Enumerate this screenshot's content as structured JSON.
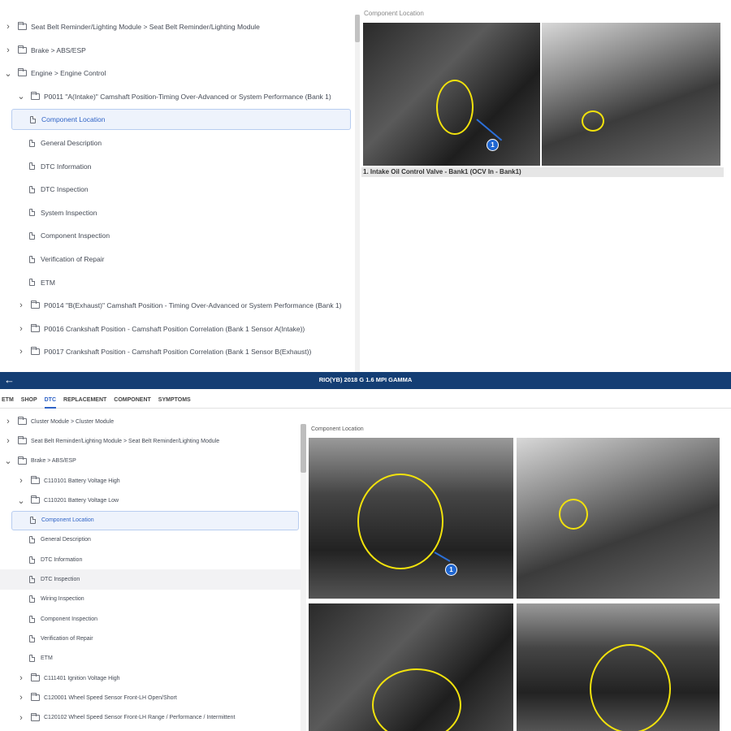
{
  "top": {
    "tree": [
      {
        "indent": 0,
        "chev": "›",
        "icon": "folder",
        "label": "Seat Belt Reminder/Lighting Module > Seat Belt Reminder/Lighting Module"
      },
      {
        "indent": 0,
        "chev": "›",
        "icon": "folder",
        "label": "Brake > ABS/ESP"
      },
      {
        "indent": 0,
        "chev": "⌄",
        "icon": "folder",
        "label": "Engine > Engine Control"
      },
      {
        "indent": 1,
        "chev": "⌄",
        "icon": "folder",
        "label": "P0011 \"A(Intake)\" Camshaft Position-Timing Over-Advanced or System Performance (Bank 1)"
      },
      {
        "indent": 2,
        "chev": "",
        "icon": "doc",
        "label": "Component Location",
        "selected": true
      },
      {
        "indent": 2,
        "chev": "",
        "icon": "doc",
        "label": "General Description"
      },
      {
        "indent": 2,
        "chev": "",
        "icon": "doc",
        "label": "DTC Information"
      },
      {
        "indent": 2,
        "chev": "",
        "icon": "doc",
        "label": "DTC Inspection"
      },
      {
        "indent": 2,
        "chev": "",
        "icon": "doc",
        "label": "System Inspection"
      },
      {
        "indent": 2,
        "chev": "",
        "icon": "doc",
        "label": "Component Inspection"
      },
      {
        "indent": 2,
        "chev": "",
        "icon": "doc",
        "label": "Verification of Repair"
      },
      {
        "indent": 2,
        "chev": "",
        "icon": "doc",
        "label": "ETM"
      },
      {
        "indent": 1,
        "chev": "›",
        "icon": "folder",
        "label": "P0014 \"B(Exhaust)\" Camshaft Position - Timing Over-Advanced or System Performance (Bank 1)"
      },
      {
        "indent": 1,
        "chev": "›",
        "icon": "folder",
        "label": "P0016 Crankshaft Position - Camshaft Position Correlation (Bank 1 Sensor A(Intake))"
      },
      {
        "indent": 1,
        "chev": "›",
        "icon": "folder",
        "label": "P0017 Crankshaft Position - Camshaft Position Correlation (Bank 1 Sensor B(Exhaust))"
      }
    ],
    "section_title": "Component Location",
    "caption": "1. Intake Oil Control Valve - Bank1 (OCV In - Bank1)",
    "badge": "1"
  },
  "bottom": {
    "back_icon": "←",
    "vehicle_title": "RIO(YB) 2018 G 1.6 MPI GAMMA",
    "tabs": [
      "ETM",
      "SHOP",
      "DTC",
      "REPLACEMENT",
      "COMPONENT",
      "SYMPTOMS"
    ],
    "active_tab": "DTC",
    "tree": [
      {
        "indent": 0,
        "chev": "›",
        "icon": "folder",
        "label": "Cluster Module > Cluster Module"
      },
      {
        "indent": 0,
        "chev": "›",
        "icon": "folder",
        "label": "Seat Belt Reminder/Lighting Module > Seat Belt Reminder/Lighting Module"
      },
      {
        "indent": 0,
        "chev": "⌄",
        "icon": "folder",
        "label": "Brake > ABS/ESP"
      },
      {
        "indent": 1,
        "chev": "›",
        "icon": "folder",
        "label": "C110101 Battery Voltage High"
      },
      {
        "indent": 1,
        "chev": "⌄",
        "icon": "folder",
        "label": "C110201 Battery Voltage Low"
      },
      {
        "indent": 2,
        "chev": "",
        "icon": "doc",
        "label": "Component Location",
        "selected": true
      },
      {
        "indent": 2,
        "chev": "",
        "icon": "doc",
        "label": "General Description"
      },
      {
        "indent": 2,
        "chev": "",
        "icon": "doc",
        "label": "DTC Information"
      },
      {
        "indent": 2,
        "chev": "",
        "icon": "doc",
        "label": "DTC Inspection",
        "hover": true
      },
      {
        "indent": 2,
        "chev": "",
        "icon": "doc",
        "label": "Wiring Inspection"
      },
      {
        "indent": 2,
        "chev": "",
        "icon": "doc",
        "label": "Component Inspection"
      },
      {
        "indent": 2,
        "chev": "",
        "icon": "doc",
        "label": "Verification of Repair"
      },
      {
        "indent": 2,
        "chev": "",
        "icon": "doc",
        "label": "ETM"
      },
      {
        "indent": 1,
        "chev": "›",
        "icon": "folder",
        "label": "C111401 Ignition Voltage High"
      },
      {
        "indent": 1,
        "chev": "›",
        "icon": "folder",
        "label": "C120001 Wheel Speed Sensor Front-LH Open/Short"
      },
      {
        "indent": 1,
        "chev": "›",
        "icon": "folder",
        "label": "C120102 Wheel Speed Sensor Front-LH Range / Performance / Intermittent"
      }
    ],
    "section_title": "Component Location",
    "badge": "1"
  },
  "colors": {
    "titlebar": "#143e74",
    "accent": "#2f63c6",
    "highlight_circle": "#f2e20c"
  }
}
